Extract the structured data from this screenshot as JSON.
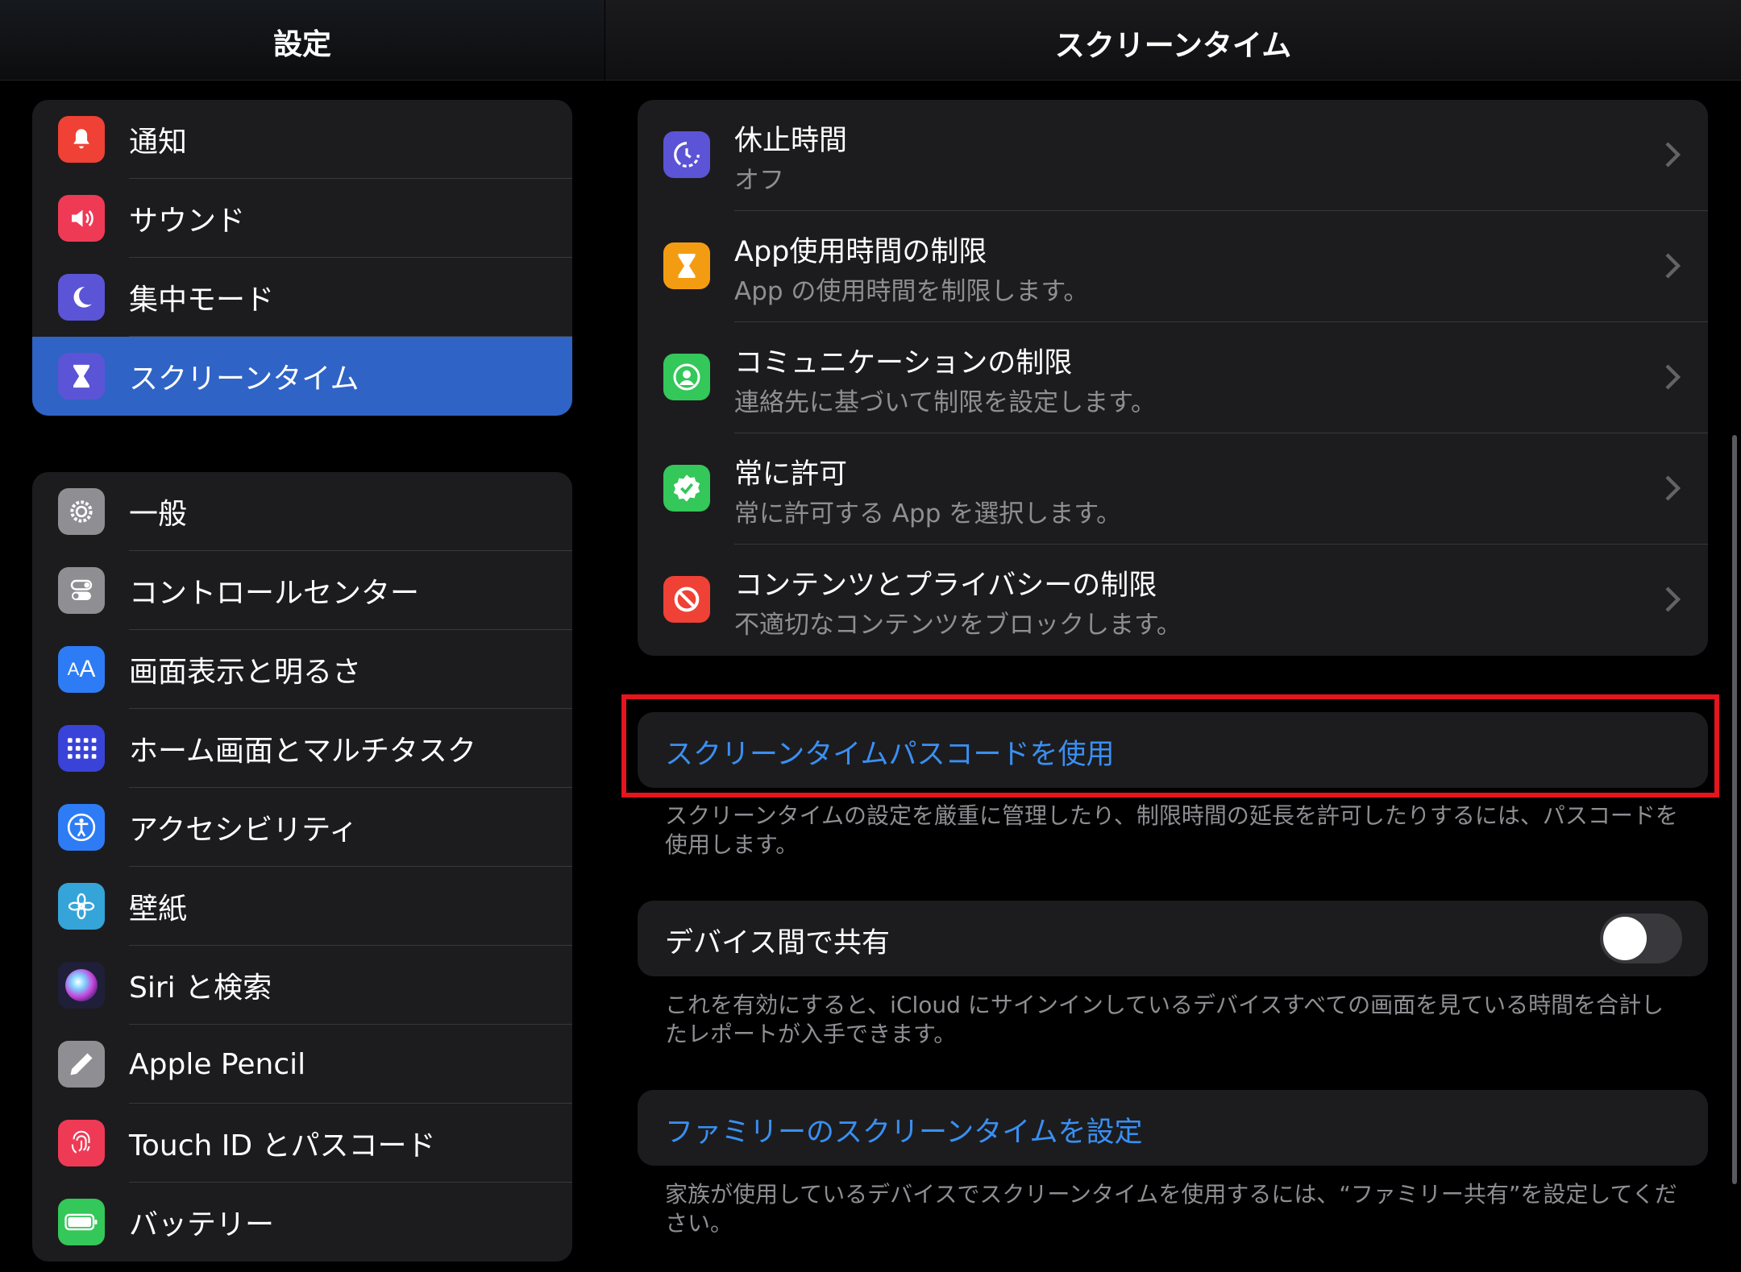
{
  "sidebar": {
    "title": "設定",
    "group1": [
      {
        "label": "通知",
        "icon": "bell-icon",
        "color": "#ef4135"
      },
      {
        "label": "サウンド",
        "icon": "speaker-icon",
        "color": "#ef3a56"
      },
      {
        "label": "集中モード",
        "icon": "moon-icon",
        "color": "#5b54d6"
      },
      {
        "label": "スクリーンタイム",
        "icon": "hourglass-icon",
        "color": "#5b54d6",
        "selected": true
      }
    ],
    "group2": [
      {
        "label": "一般",
        "icon": "gear-icon",
        "color": "#8e8e93"
      },
      {
        "label": "コントロールセンター",
        "icon": "toggle-switches-icon",
        "color": "#8e8e93"
      },
      {
        "label": "画面表示と明るさ",
        "icon": "text-size-icon",
        "color": "#2d7cf6"
      },
      {
        "label": "ホーム画面とマルチタスク",
        "icon": "app-grid-icon",
        "color": "#3a43d8"
      },
      {
        "label": "アクセシビリティ",
        "icon": "accessibility-icon",
        "color": "#2d7cf6"
      },
      {
        "label": "壁紙",
        "icon": "flower-icon",
        "color": "#35a4d8"
      },
      {
        "label": "Siri と検索",
        "icon": "siri-icon",
        "color": "#1f1f3a"
      },
      {
        "label": "Apple Pencil",
        "icon": "pencil-icon",
        "color": "#8e8e93"
      },
      {
        "label": "Touch ID とパスコード",
        "icon": "fingerprint-icon",
        "color": "#ef3a56"
      },
      {
        "label": "バッテリー",
        "icon": "battery-icon",
        "color": "#34c759"
      }
    ],
    "selected_color": "#2f63c6"
  },
  "detail": {
    "title": "スクリーンタイム",
    "rows": [
      {
        "title": "休止時間",
        "subtitle": "オフ",
        "icon": "downtime-icon",
        "color": "#5b54d6"
      },
      {
        "title": "App使用時間の制限",
        "subtitle": "App の使用時間を制限します。",
        "icon": "hourglass-icon",
        "color": "#f39c12"
      },
      {
        "title": "コミュニケーションの制限",
        "subtitle": "連絡先に基づいて制限を設定します。",
        "icon": "contact-icon",
        "color": "#34c759"
      },
      {
        "title": "常に許可",
        "subtitle": "常に許可する App を選択します。",
        "icon": "checkmark-badge-icon",
        "color": "#34c759"
      },
      {
        "title": "コンテンツとプライバシーの制限",
        "subtitle": "不適切なコンテンツをブロックします。",
        "icon": "no-entry-icon",
        "color": "#ef4135"
      }
    ],
    "passcode": {
      "label": "スクリーンタイムパスコードを使用",
      "note": "スクリーンタイムの設定を厳重に管理したり、制限時間の延長を許可したりするには、パスコードを使用します。"
    },
    "share": {
      "label": "デバイス間で共有",
      "enabled": false,
      "note": "これを有効にすると、iCloud にサインインしているデバイスすべての画面を見ている時間を合計したレポートが入手できます。"
    },
    "family": {
      "label": "ファミリーのスクリーンタイムを設定",
      "note": "家族が使用しているデバイスでスクリーンタイムを使用するには、“ファミリー共有”を設定してください。"
    },
    "link_color": "#3a8ff2",
    "highlight_color": "#e5141e"
  }
}
